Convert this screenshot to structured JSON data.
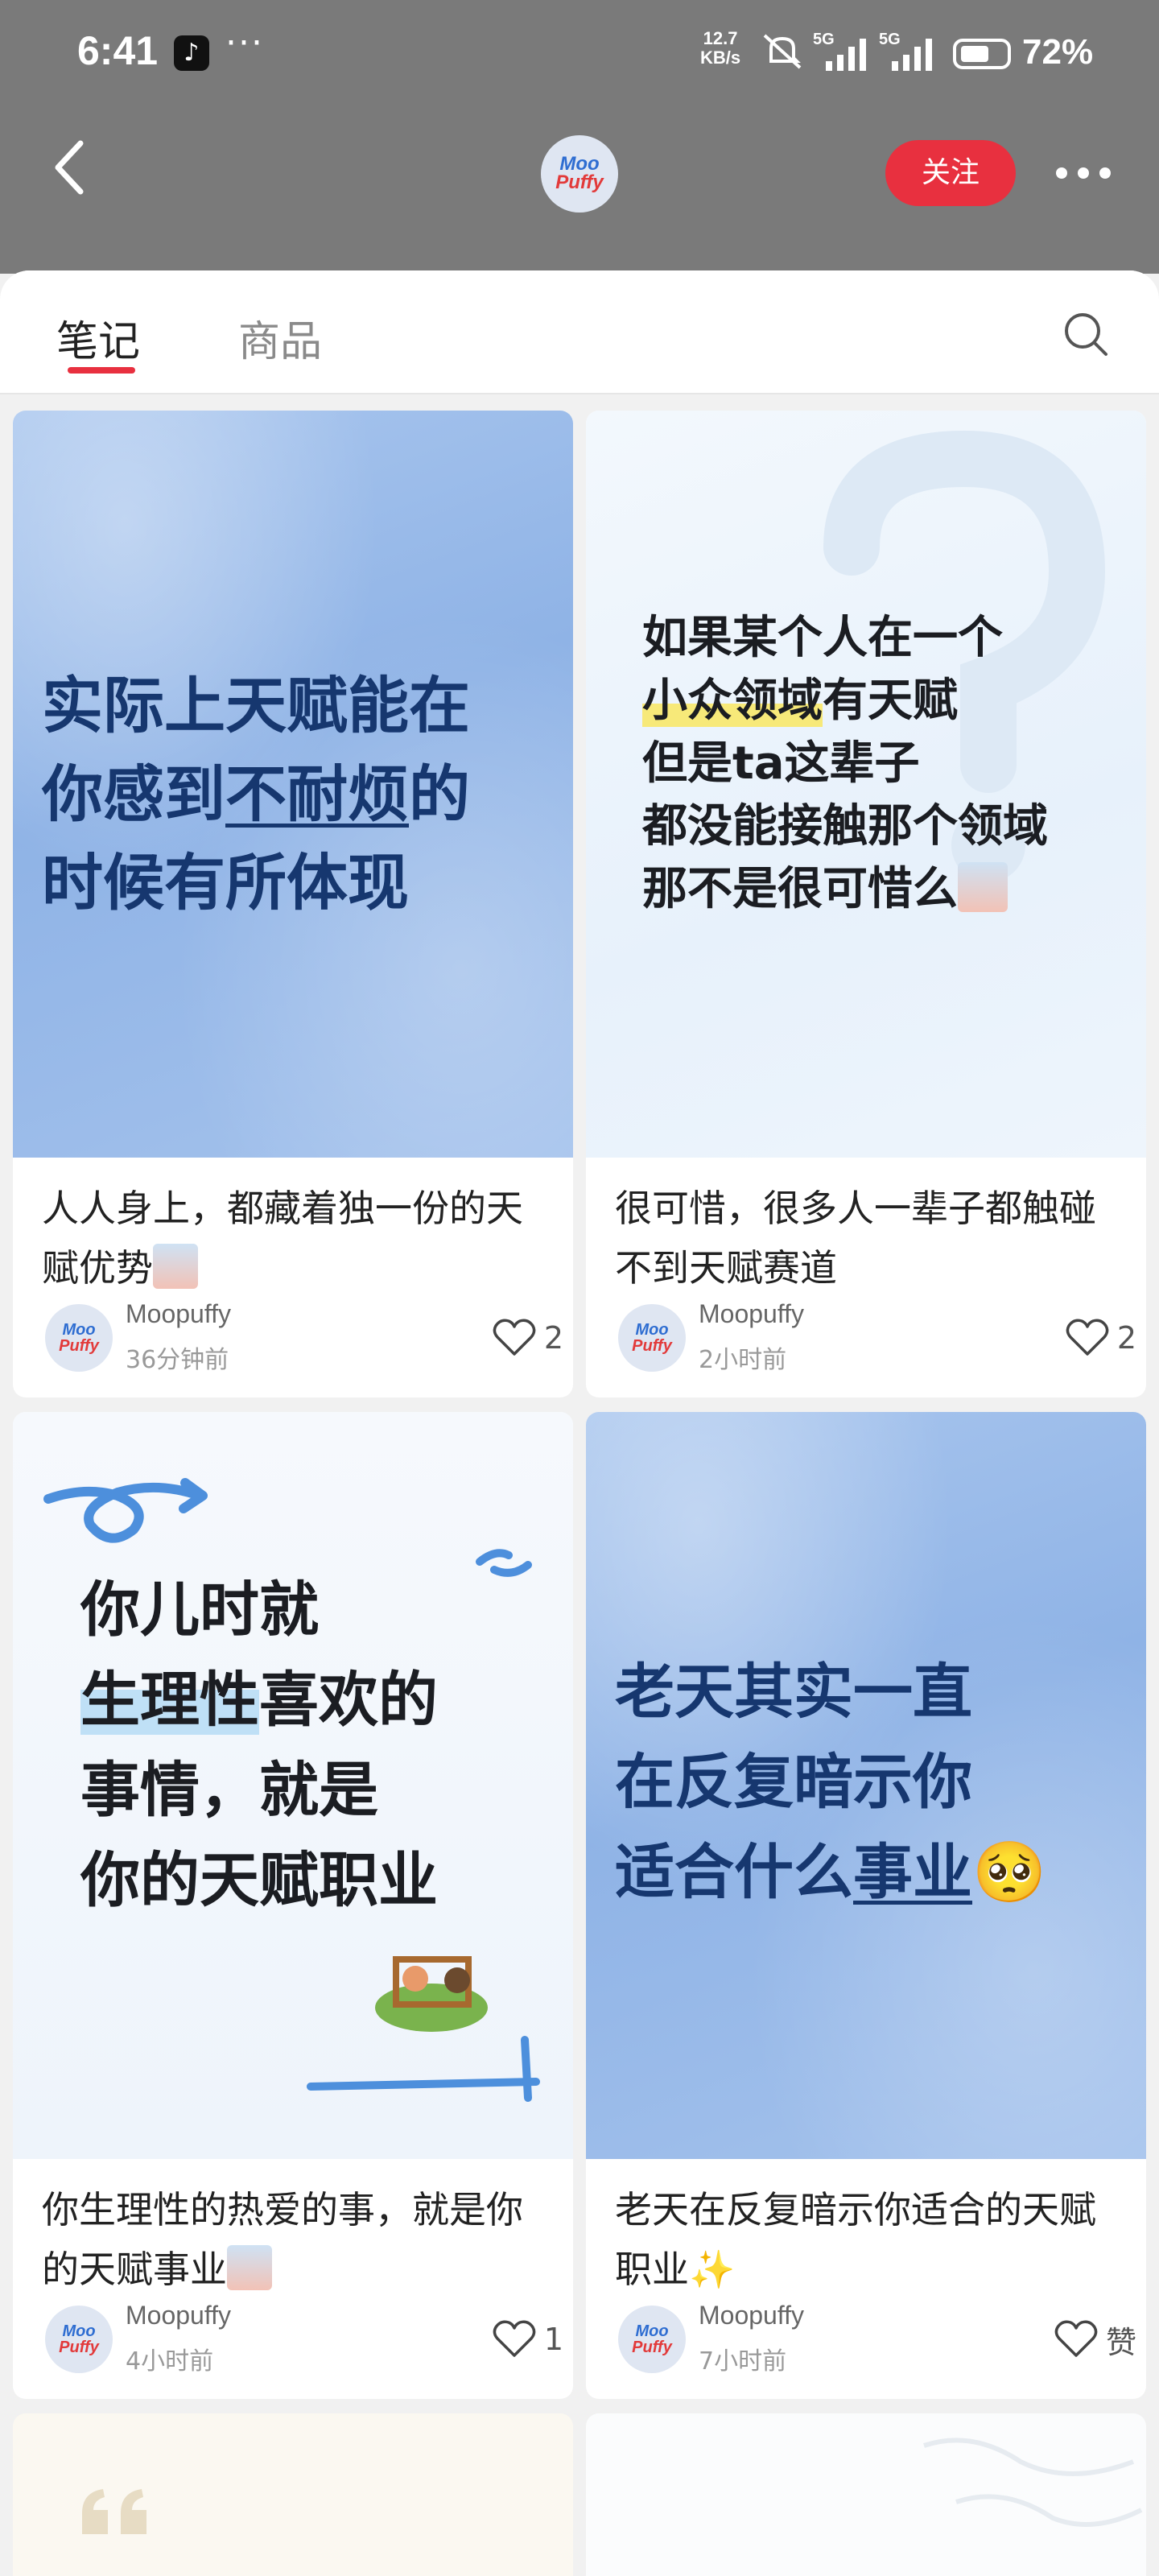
{
  "status_bar": {
    "time": "6:41",
    "tiktok_glyph": "♪",
    "more_dots": "···",
    "net_speed_value": "12.7",
    "net_speed_unit": "KB/s",
    "signal1_label": "5G",
    "signal2_label": "5G",
    "battery": "72%"
  },
  "header": {
    "logo_line1": "Moo",
    "logo_line2": "Puffy",
    "follow_label": "关注"
  },
  "tabs": [
    {
      "label": "笔记",
      "active": true
    },
    {
      "label": "商品",
      "active": false
    }
  ],
  "cards": [
    {
      "cover_lines": [
        "实际上天赋能在",
        "你感到",
        "不耐烦",
        "的",
        "时候有所体现"
      ],
      "title": "人人身上，都藏着独一份的天赋优势",
      "author": "Moopuffy",
      "time": "36分钟前",
      "likes": "2"
    },
    {
      "cover_lines": [
        "如果某个人在一个",
        "小众领域",
        "有天赋",
        "但是ta这辈子",
        "都没能接触那个领域",
        "那不是很可惜么"
      ],
      "title": "很可惜，很多人一辈子都触碰不到天赋赛道",
      "author": "Moopuffy",
      "time": "2小时前",
      "likes": "2"
    },
    {
      "cover_lines": [
        "你儿时就",
        "生理性",
        "喜欢的",
        "事情，就是",
        "你的天赋职业"
      ],
      "title": "你生理性的热爱的事，就是你的天赋事业",
      "author": "Moopuffy",
      "time": "4小时前",
      "likes": "1"
    },
    {
      "cover_lines": [
        "老天其实一直",
        "在反复暗示你",
        "适合什么",
        "事业",
        "🥺"
      ],
      "title": "老天在反复暗示你适合的天赋职业✨",
      "author": "Moopuffy",
      "time": "7小时前",
      "likes": "赞"
    }
  ],
  "icons": {
    "back": "chevron-left-icon",
    "more": "more-horizontal-icon",
    "search": "search-icon",
    "like": "heart-outline-icon"
  }
}
